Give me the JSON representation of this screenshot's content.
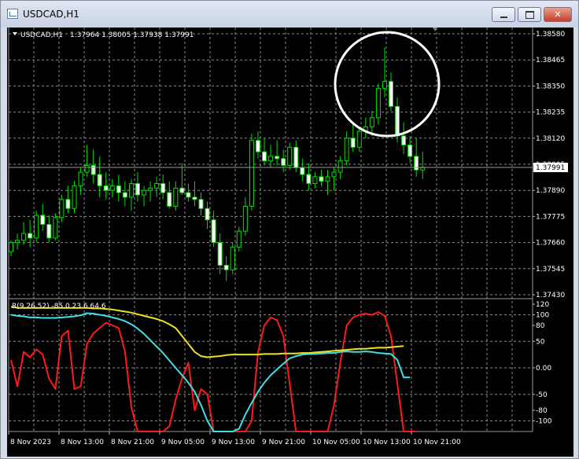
{
  "window": {
    "title": "USDCAD,H1",
    "minimize_icon": "minimize-icon",
    "maximize_icon": "maximize-icon",
    "close_icon": "close-icon"
  },
  "colors": {
    "background": "#000000",
    "grid": "#8c8c8c",
    "candle": "#00e000",
    "indicator_red": "#ff1a1a",
    "indicator_cyan": "#3ee0e8",
    "indicator_yellow": "#f0e020",
    "annotation_circle": "#ffffff"
  },
  "price_header": {
    "symbol": "USDCAD,H1",
    "ohlc": "1.37964 1.38005 1.37938 1.37991"
  },
  "indicator_header": {
    "label": "R(9,26,52) -85.0 23.6 64.6"
  },
  "current_price": "1.37991",
  "chart_data": [
    {
      "type": "candlestick",
      "ylim": [
        1.3743,
        1.3858
      ],
      "y_ticks": [
        "1.38580",
        "1.38465",
        "1.38350",
        "1.38235",
        "1.38120",
        "1.38005",
        "1.37890",
        "1.37775",
        "1.37660",
        "1.37545",
        "1.37430"
      ],
      "x_ticks": [
        "8 Nov 2023",
        "8 Nov 13:00",
        "8 Nov 21:00",
        "9 Nov 05:00",
        "9 Nov 13:00",
        "9 Nov 21:00",
        "10 Nov 05:00",
        "10 Nov 13:00",
        "10 Nov 21:00"
      ],
      "candles": [
        [
          1.3762,
          1.3767,
          1.376,
          1.3766
        ],
        [
          1.3766,
          1.377,
          1.3763,
          1.3767
        ],
        [
          1.3767,
          1.3775,
          1.3765,
          1.377
        ],
        [
          1.377,
          1.3776,
          1.3764,
          1.3768
        ],
        [
          1.3768,
          1.378,
          1.3766,
          1.3778
        ],
        [
          1.3778,
          1.3783,
          1.3771,
          1.3774
        ],
        [
          1.3774,
          1.3778,
          1.3766,
          1.3768
        ],
        [
          1.3768,
          1.3779,
          1.3767,
          1.3777
        ],
        [
          1.3777,
          1.3787,
          1.3775,
          1.3785
        ],
        [
          1.3785,
          1.3791,
          1.3779,
          1.3781
        ],
        [
          1.3781,
          1.3793,
          1.3779,
          1.3791
        ],
        [
          1.3791,
          1.3799,
          1.3787,
          1.3797
        ],
        [
          1.3797,
          1.3809,
          1.3795,
          1.38
        ],
        [
          1.38,
          1.3807,
          1.3792,
          1.3796
        ],
        [
          1.3796,
          1.3804,
          1.3786,
          1.3791
        ],
        [
          1.3791,
          1.3797,
          1.3785,
          1.3789
        ],
        [
          1.3789,
          1.3794,
          1.3786,
          1.3791
        ],
        [
          1.3791,
          1.3796,
          1.3784,
          1.3788
        ],
        [
          1.3788,
          1.3793,
          1.3782,
          1.3786
        ],
        [
          1.3786,
          1.3794,
          1.378,
          1.3792
        ],
        [
          1.3792,
          1.3797,
          1.3784,
          1.3787
        ],
        [
          1.3787,
          1.3791,
          1.3782,
          1.3789
        ],
        [
          1.3789,
          1.3793,
          1.3784,
          1.379
        ],
        [
          1.379,
          1.3795,
          1.3786,
          1.3792
        ],
        [
          1.3792,
          1.3796,
          1.3785,
          1.3788
        ],
        [
          1.3788,
          1.3793,
          1.3781,
          1.3782
        ],
        [
          1.3782,
          1.3793,
          1.378,
          1.379
        ],
        [
          1.379,
          1.3801,
          1.3787,
          1.3788
        ],
        [
          1.3788,
          1.3792,
          1.3784,
          1.3786
        ],
        [
          1.3786,
          1.3793,
          1.3782,
          1.3785
        ],
        [
          1.3785,
          1.3788,
          1.3778,
          1.3781
        ],
        [
          1.3781,
          1.3784,
          1.3772,
          1.3776
        ],
        [
          1.3776,
          1.378,
          1.3764,
          1.3766
        ],
        [
          1.3766,
          1.377,
          1.3752,
          1.3756
        ],
        [
          1.3756,
          1.376,
          1.3749,
          1.3754
        ],
        [
          1.3754,
          1.3766,
          1.3752,
          1.3764
        ],
        [
          1.3764,
          1.3773,
          1.3762,
          1.3771
        ],
        [
          1.3771,
          1.3786,
          1.3769,
          1.3782
        ],
        [
          1.3782,
          1.3814,
          1.378,
          1.3811
        ],
        [
          1.3811,
          1.3815,
          1.3803,
          1.3806
        ],
        [
          1.3806,
          1.3812,
          1.38,
          1.3802
        ],
        [
          1.3802,
          1.3809,
          1.3799,
          1.3804
        ],
        [
          1.3804,
          1.3811,
          1.38,
          1.3803
        ],
        [
          1.3803,
          1.3807,
          1.3797,
          1.38
        ],
        [
          1.38,
          1.381,
          1.3798,
          1.3808
        ],
        [
          1.3808,
          1.3811,
          1.3797,
          1.3799
        ],
        [
          1.3799,
          1.3803,
          1.3793,
          1.3796
        ],
        [
          1.3796,
          1.3801,
          1.3789,
          1.3792
        ],
        [
          1.3792,
          1.3797,
          1.379,
          1.3795
        ],
        [
          1.3795,
          1.3798,
          1.3791,
          1.3793
        ],
        [
          1.3793,
          1.3798,
          1.3787,
          1.3795
        ],
        [
          1.3795,
          1.3799,
          1.3789,
          1.3797
        ],
        [
          1.3797,
          1.3804,
          1.3794,
          1.3802
        ],
        [
          1.3802,
          1.3815,
          1.38,
          1.3812
        ],
        [
          1.3812,
          1.3818,
          1.3806,
          1.3808
        ],
        [
          1.3808,
          1.3817,
          1.3806,
          1.3815
        ],
        [
          1.3815,
          1.3821,
          1.3812,
          1.3817
        ],
        [
          1.3817,
          1.3824,
          1.3813,
          1.3821
        ],
        [
          1.3821,
          1.3836,
          1.3818,
          1.3834
        ],
        [
          1.3834,
          1.3852,
          1.383,
          1.3837
        ],
        [
          1.3837,
          1.3841,
          1.3824,
          1.3826
        ],
        [
          1.3826,
          1.383,
          1.381,
          1.3813
        ],
        [
          1.3813,
          1.3819,
          1.3805,
          1.3809
        ],
        [
          1.3809,
          1.3813,
          1.3801,
          1.3804
        ],
        [
          1.3804,
          1.3812,
          1.3795,
          1.3798
        ],
        [
          1.3798,
          1.3806,
          1.3794,
          1.3799
        ]
      ]
    },
    {
      "type": "line",
      "ylim": [
        -120,
        120
      ],
      "y_ticks": [
        "120",
        "100",
        "80",
        "50",
        "0.00",
        "-50",
        "-80",
        "-100"
      ],
      "series": [
        {
          "name": "9",
          "color": "#ff1a1a",
          "values": [
            15,
            -35,
            30,
            20,
            35,
            25,
            -20,
            -40,
            60,
            70,
            -40,
            -35,
            45,
            65,
            75,
            85,
            80,
            75,
            30,
            -75,
            -140,
            -155,
            -150,
            -150,
            -150,
            -110,
            -60,
            -20,
            10,
            -80,
            -40,
            -50,
            -120,
            -128,
            -130,
            -135,
            -160,
            -160,
            -100,
            30,
            80,
            95,
            90,
            60,
            -30,
            -140,
            -145,
            -150,
            -150,
            -145,
            -130,
            -70,
            10,
            80,
            95,
            100,
            102,
            100,
            105,
            98,
            60,
            -30,
            -140,
            -160,
            -185
          ]
        },
        {
          "name": "26",
          "color": "#3ee0e8",
          "values": [
            100,
            98,
            97,
            95,
            95,
            94,
            94,
            94,
            95,
            96,
            97,
            99,
            103,
            102,
            100,
            98,
            95,
            92,
            88,
            82,
            74,
            64,
            52,
            40,
            28,
            14,
            0,
            -14,
            -28,
            -45,
            -70,
            -100,
            -135,
            -148,
            -150,
            -150,
            -115,
            -88,
            -66,
            -45,
            -28,
            -14,
            -3,
            8,
            18,
            22,
            25,
            26,
            26,
            27,
            28,
            28,
            30,
            31,
            30,
            30,
            31,
            30,
            28,
            27,
            26,
            15,
            -18,
            -18
          ]
        },
        {
          "name": "52",
          "color": "#f0e020",
          "values": [
            115,
            113,
            113,
            113,
            113,
            113,
            113,
            113,
            113,
            113,
            113,
            113,
            113,
            112,
            112,
            111,
            110,
            108,
            106,
            104,
            101,
            98,
            95,
            92,
            88,
            82,
            75,
            60,
            45,
            30,
            22,
            20,
            21,
            22,
            24,
            25,
            25,
            25,
            25,
            25,
            26,
            26,
            26,
            27,
            27,
            27,
            28,
            28,
            29,
            30,
            31,
            32,
            33,
            34,
            35,
            36,
            36,
            37,
            38,
            38,
            39,
            40,
            41
          ]
        }
      ]
    }
  ]
}
